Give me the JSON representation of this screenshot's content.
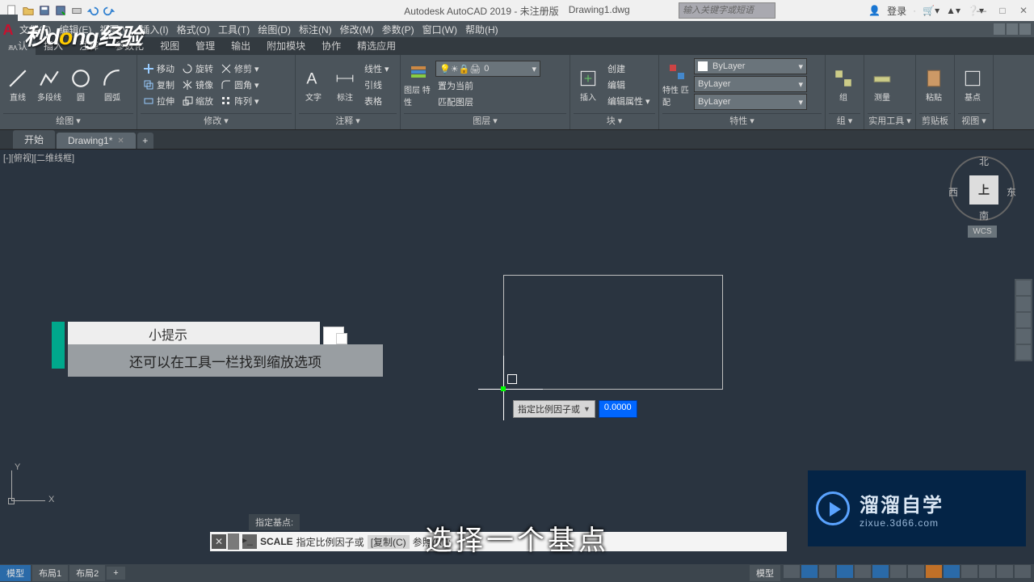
{
  "title": {
    "app": "Autodesk AutoCAD 2019 - 未注册版",
    "doc": "Drawing1.dwg",
    "search_ph": "输入关键字或短语",
    "login": "登录"
  },
  "menu": [
    "文件(F)",
    "编辑(E)",
    "视图(V)",
    "插入(I)",
    "格式(O)",
    "工具(T)",
    "绘图(D)",
    "标注(N)",
    "修改(M)",
    "参数(P)",
    "窗口(W)",
    "帮助(H)"
  ],
  "tabstrip": {
    "t0": "默认",
    "t1": "插入",
    "t2": "注释",
    "t3": "参数化",
    "t4": "视图",
    "t5": "管理",
    "t6": "输出",
    "t7": "附加模块",
    "t8": "协作",
    "t9": "精选应用"
  },
  "ribbon": {
    "draw": {
      "title": "绘图 ▾",
      "b1": "直线",
      "b2": "多段线",
      "b3": "圆",
      "b4": "圆弧"
    },
    "modify": {
      "title": "修改 ▾",
      "r1": "移动",
      "r2": "复制",
      "r3": "拉伸",
      "c1": "旋转",
      "c2": "镜像",
      "c3": "缩放",
      "d1": "修剪",
      "d2": "圆角",
      "d3": "阵列"
    },
    "annot": {
      "title": "注释 ▾",
      "b1": "文字",
      "b2": "标注",
      "r1": "线性",
      "r2": "引线",
      "r3": "表格"
    },
    "layer": {
      "title": "图层 ▾",
      "b1": "图层\n特性",
      "combo": "0",
      "r1": "置为当前",
      "r2": "匹配图层"
    },
    "block": {
      "title": "块 ▾",
      "b1": "插入",
      "r1": "创建",
      "r2": "编辑",
      "r3": "编辑属性"
    },
    "prop": {
      "title": "特性 ▾",
      "b1": "特性\n匹配",
      "c1": "ByLayer",
      "c2": "ByLayer",
      "c3": "ByLayer"
    },
    "group": {
      "title": "组 ▾",
      "b1": "组"
    },
    "util": {
      "title": "实用工具 ▾",
      "b1": "测量"
    },
    "clip": {
      "title": "剪贴板",
      "b1": "粘贴"
    },
    "view": {
      "title": "视图 ▾",
      "b1": "基点"
    }
  },
  "doctabs": {
    "t0": "开始",
    "t1": "Drawing1*"
  },
  "viewport": {
    "label": "[-][俯视][二维线框]",
    "cube": {
      "n": "北",
      "s": "南",
      "e": "东",
      "w": "西",
      "face": "上",
      "wcs": "WCS"
    }
  },
  "dyn": {
    "label": "指定比例因子或",
    "value": "0.0000"
  },
  "hint": {
    "title": "小提示",
    "body": "还可以在工具一栏找到缩放选项"
  },
  "cmd": {
    "hint": "指定基点:",
    "scale": "SCALE",
    "prompt": "指定比例因子或",
    "copy": "[复制(C)",
    "rest": "参照(R)]:"
  },
  "caption": "选择一个基点",
  "watermark": {
    "big": "溜溜自学",
    "small": "zixue.3d66.com"
  },
  "status": {
    "t0": "模型",
    "t1": "布局1",
    "t2": "布局2",
    "r0": "模型"
  },
  "brand": {
    "a": "秒d",
    "b": "o",
    "c": "ng经验"
  }
}
